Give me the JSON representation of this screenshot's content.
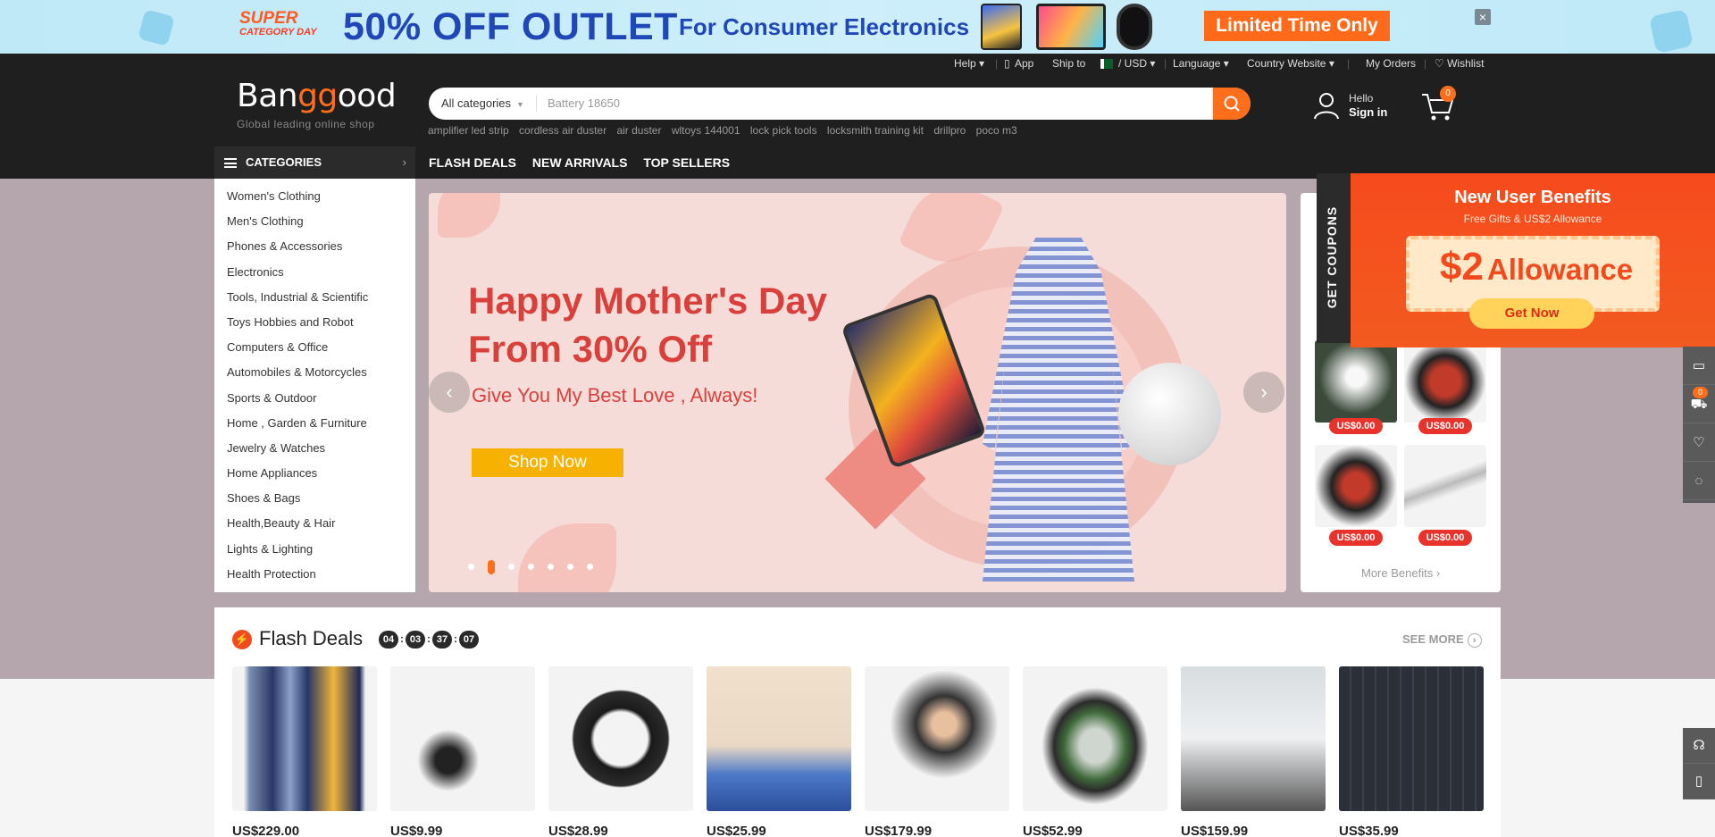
{
  "promo": {
    "super": "SUPER",
    "category_day": "CATEGORY DAY",
    "discount": "50% OFF OUTLET",
    "for_text": "For Consumer Electronics",
    "cta": "Limited Time Only",
    "close": "×"
  },
  "utility": {
    "help": "Help ▾",
    "app": "App",
    "ship_to": "Ship to",
    "currency": "/ USD ▾",
    "language": "Language ▾",
    "country": "Country Website ▾",
    "orders": "My Orders",
    "wishlist": "♡ Wishlist",
    "sep": "|"
  },
  "logo": {
    "part1": "Ban",
    "part2": "gg",
    "part3": "ood",
    "tagline": "Global leading online shop"
  },
  "search": {
    "category": "All categories",
    "placeholder": "Battery 18650",
    "hot_keywords": [
      "amplifier led strip",
      "cordless air duster",
      "air duster",
      "wltoys 144001",
      "lock pick tools",
      "locksmith training kit",
      "drillpro",
      "poco m3"
    ]
  },
  "account": {
    "hello": "Hello",
    "sign_in": "Sign in",
    "cart_count": "0"
  },
  "nav": {
    "categories": "CATEGORIES",
    "links": [
      "FLASH DEALS",
      "NEW ARRIVALS",
      "TOP SELLERS"
    ]
  },
  "categories": [
    "Women's Clothing",
    "Men's Clothing",
    "Phones & Accessories",
    "Electronics",
    "Tools, Industrial & Scientific",
    "Toys Hobbies and Robot",
    "Computers & Office",
    "Automobiles & Motorcycles",
    "Sports & Outdoor",
    "Home , Garden & Furniture",
    "Jewelry & Watches",
    "Home Appliances",
    "Shoes & Bags",
    "Health,Beauty & Hair",
    "Lights & Lighting",
    "Health Protection"
  ],
  "hero": {
    "headline_line1": "Happy Mother's Day",
    "headline_line2": "From 30% Off",
    "subline": "Give You My Best Love , Always!",
    "cta": "Shop Now",
    "slide_count": 7,
    "active_slide": 2
  },
  "coupons": {
    "tab": "GET COUPONS",
    "title": "New User Benefits",
    "subtitle": "Free Gifts & US$2 Allowance",
    "amount": "$2",
    "amount_label": "Allowance",
    "get_now": "Get Now",
    "prices": [
      "US$0.00",
      "US$0.00",
      "US$0.00",
      "US$0.00"
    ],
    "more": "More Benefits ›"
  },
  "sidebar_tools": {
    "cart_badge": "0"
  },
  "flash": {
    "title": "Flash Deals",
    "timer": [
      "04",
      "03",
      "37",
      "07"
    ],
    "see_more": "SEE MORE",
    "prices": [
      "US$229.00",
      "US$9.99",
      "US$28.99",
      "US$25.99",
      "US$179.99",
      "US$52.99",
      "US$159.99",
      "US$35.99"
    ]
  },
  "colors": {
    "brand_orange": "#ff6e1a",
    "header_dark": "#1f1f1f",
    "hero_red": "#d9403c",
    "flash_red": "#f04a1d"
  }
}
